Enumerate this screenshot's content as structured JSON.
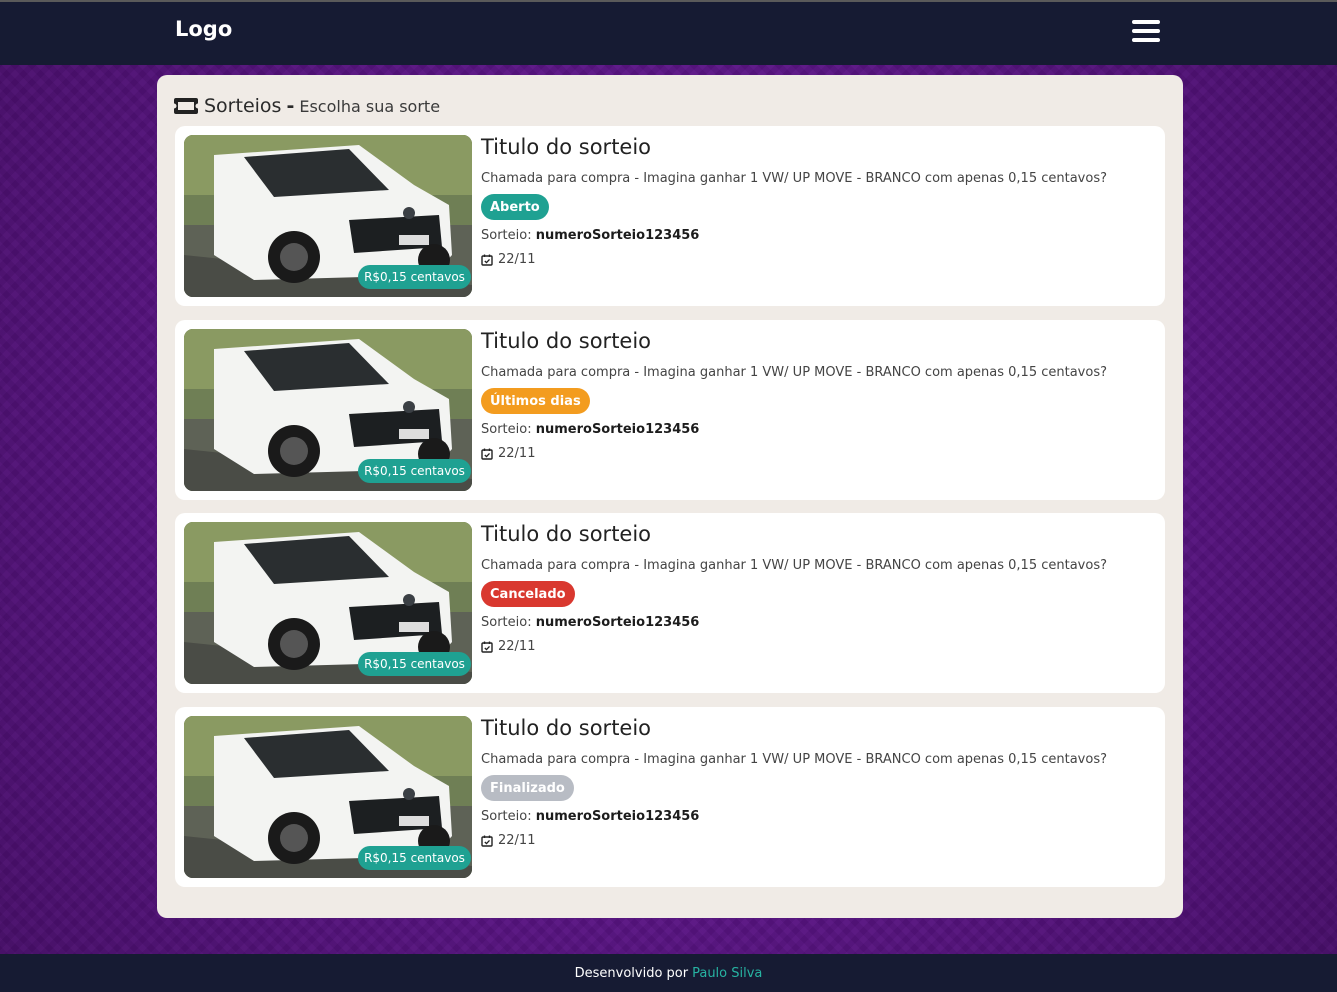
{
  "navbar": {
    "logo": "Logo",
    "menu_icon": "hamburger-icon"
  },
  "panel": {
    "title": "Sorteios",
    "separator": "-",
    "subtitle": "Escolha sua sorte",
    "icon": "ticket-icon"
  },
  "cards": [
    {
      "title": "Titulo do sorteio",
      "description": "Chamada para compra - Imagina ganhar 1 VW/ UP MOVE - BRANCO com apenas 0,15 centavos?",
      "status": "Aberto",
      "status_color": "#1fa192",
      "number_label": "Sorteio:",
      "number": "numeroSorteio123456",
      "date": "22/11",
      "price": "R$0,15 centavos"
    },
    {
      "title": "Titulo do sorteio",
      "description": "Chamada para compra - Imagina ganhar 1 VW/ UP MOVE - BRANCO com apenas 0,15 centavos?",
      "status": "Últimos dias",
      "status_color": "#f39c1f",
      "number_label": "Sorteio:",
      "number": "numeroSorteio123456",
      "date": "22/11",
      "price": "R$0,15 centavos"
    },
    {
      "title": "Titulo do sorteio",
      "description": "Chamada para compra - Imagina ganhar 1 VW/ UP MOVE - BRANCO com apenas 0,15 centavos?",
      "status": "Cancelado",
      "status_color": "#d9382f",
      "number_label": "Sorteio:",
      "number": "numeroSorteio123456",
      "date": "22/11",
      "price": "R$0,15 centavos"
    },
    {
      "title": "Titulo do sorteio",
      "description": "Chamada para compra - Imagina ganhar 1 VW/ UP MOVE - BRANCO com apenas 0,15 centavos?",
      "status": "Finalizado",
      "status_color": "#b8bcc4",
      "number_label": "Sorteio:",
      "number": "numeroSorteio123456",
      "date": "22/11",
      "price": "R$0,15 centavos"
    }
  ],
  "footer": {
    "text": "Desenvolvido por",
    "author": "Paulo Silva",
    "author_color": "#27b3a2"
  }
}
